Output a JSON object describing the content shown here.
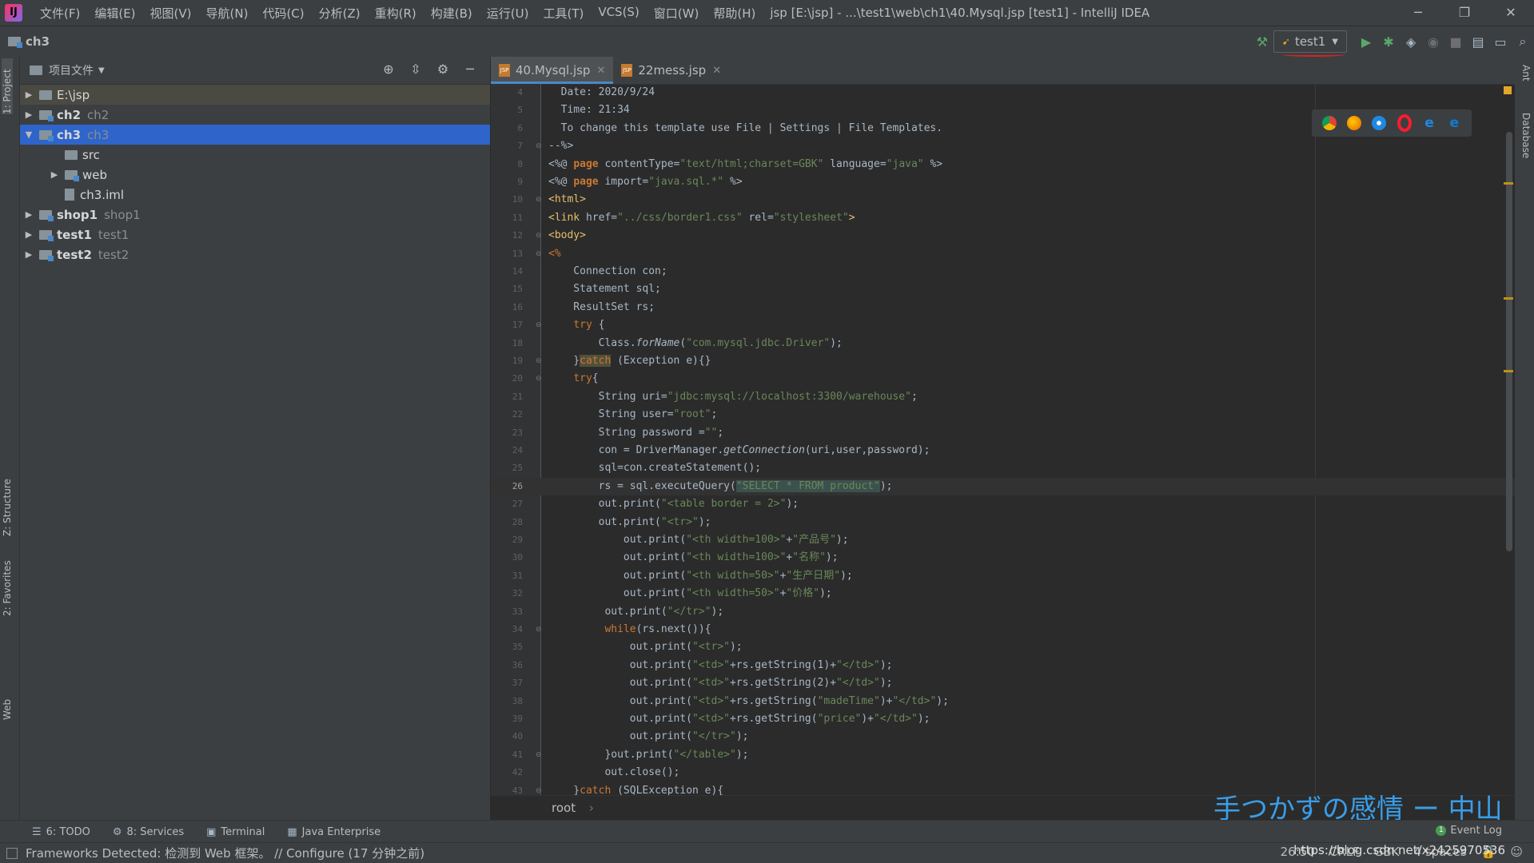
{
  "menubar": {
    "items": [
      "文件(F)",
      "编辑(E)",
      "视图(V)",
      "导航(N)",
      "代码(C)",
      "分析(Z)",
      "重构(R)",
      "构建(B)",
      "运行(U)",
      "工具(T)",
      "VCS(S)",
      "窗口(W)",
      "帮助(H)"
    ],
    "window_title": "jsp [E:\\jsp] - ...\\test1\\web\\ch1\\40.Mysql.jsp [test1] - IntelliJ IDEA"
  },
  "navbar": {
    "crumb": "ch3",
    "run_config": "test1"
  },
  "left_tabs": [
    "1: Project",
    "Z: Structure",
    "2: Favorites",
    "Web"
  ],
  "right_tabs": [
    "Ant",
    "Database"
  ],
  "project_panel": {
    "title": "项目文件",
    "tree": [
      {
        "name": "E:\\jsp",
        "sub": "",
        "depth": 0,
        "arrow": "▶",
        "bold": false,
        "state": "highlight",
        "icon": "folder"
      },
      {
        "name": "ch2",
        "sub": "ch2",
        "depth": 0,
        "arrow": "▶",
        "bold": true,
        "state": "",
        "icon": "module"
      },
      {
        "name": "ch3",
        "sub": "ch3",
        "depth": 0,
        "arrow": "▼",
        "bold": true,
        "state": "selected",
        "icon": "module"
      },
      {
        "name": "src",
        "sub": "",
        "depth": 1,
        "arrow": "",
        "bold": false,
        "state": "",
        "icon": "folder"
      },
      {
        "name": "web",
        "sub": "",
        "depth": 1,
        "arrow": "▶",
        "bold": false,
        "state": "",
        "icon": "folder"
      },
      {
        "name": "ch3.iml",
        "sub": "",
        "depth": 1,
        "arrow": "",
        "bold": false,
        "state": "",
        "icon": "file"
      },
      {
        "name": "shop1",
        "sub": "shop1",
        "depth": 0,
        "arrow": "▶",
        "bold": true,
        "state": "",
        "icon": "module"
      },
      {
        "name": "test1",
        "sub": "test1",
        "depth": 0,
        "arrow": "▶",
        "bold": true,
        "state": "",
        "icon": "module"
      },
      {
        "name": "test2",
        "sub": "test2",
        "depth": 0,
        "arrow": "▶",
        "bold": true,
        "state": "",
        "icon": "module"
      }
    ]
  },
  "editor": {
    "tabs": [
      {
        "label": "40.Mysql.jsp",
        "active": true
      },
      {
        "label": "22mess.jsp",
        "active": false
      }
    ],
    "current_line": 26,
    "lines": [
      {
        "n": 4,
        "fold": "",
        "segs": [
          [
            "",
            "  Date: 2020/9/24"
          ]
        ]
      },
      {
        "n": 5,
        "fold": "",
        "segs": [
          [
            "",
            "  Time: 21:34"
          ]
        ]
      },
      {
        "n": 6,
        "fold": "",
        "segs": [
          [
            "",
            "  To change this template use File | Settings | File Templates."
          ]
        ]
      },
      {
        "n": 7,
        "fold": "⊖",
        "segs": [
          [
            "",
            "--%>"
          ]
        ]
      },
      {
        "n": 8,
        "fold": "",
        "segs": [
          [
            "",
            "<%@ "
          ],
          [
            "dir",
            "page"
          ],
          [
            "",
            " contentType="
          ],
          [
            "str",
            "\"text/html;charset=GBK\""
          ],
          [
            "",
            " language="
          ],
          [
            "str",
            "\"java\""
          ],
          [
            "",
            " %>"
          ]
        ]
      },
      {
        "n": 9,
        "fold": "",
        "segs": [
          [
            "",
            "<%@ "
          ],
          [
            "dir",
            "page"
          ],
          [
            "",
            " import="
          ],
          [
            "str",
            "\"java.sql.*\""
          ],
          [
            "",
            " %>"
          ]
        ]
      },
      {
        "n": 10,
        "fold": "⊖",
        "segs": [
          [
            "tag",
            "<html>"
          ]
        ]
      },
      {
        "n": 11,
        "fold": "",
        "segs": [
          [
            "tag",
            "<link "
          ],
          [
            "",
            "href="
          ],
          [
            "str",
            "\"../css/border1.css\""
          ],
          [
            "",
            " rel="
          ],
          [
            "str",
            "\"stylesheet\""
          ],
          [
            "tag",
            ">"
          ]
        ]
      },
      {
        "n": 12,
        "fold": "⊖",
        "segs": [
          [
            "tag",
            "<body>"
          ]
        ]
      },
      {
        "n": 13,
        "fold": "⊖",
        "segs": [
          [
            "kw",
            "<%"
          ]
        ]
      },
      {
        "n": 14,
        "fold": "",
        "segs": [
          [
            "",
            "    Connection con;"
          ]
        ]
      },
      {
        "n": 15,
        "fold": "",
        "segs": [
          [
            "",
            "    Statement sql;"
          ]
        ]
      },
      {
        "n": 16,
        "fold": "",
        "segs": [
          [
            "",
            "    ResultSet rs;"
          ]
        ]
      },
      {
        "n": 17,
        "fold": "⊖",
        "segs": [
          [
            "",
            "    "
          ],
          [
            "kw",
            "try"
          ],
          [
            "",
            " {"
          ]
        ]
      },
      {
        "n": 18,
        "fold": "",
        "segs": [
          [
            "",
            "        Class."
          ],
          [
            "it",
            "forName"
          ],
          [
            "",
            "("
          ],
          [
            "str",
            "\"com.mysql.jdbc.Driver\""
          ],
          [
            "",
            ");"
          ]
        ]
      },
      {
        "n": 19,
        "fold": "⊖",
        "segs": [
          [
            "",
            "    }"
          ],
          [
            "warn",
            "catch"
          ],
          [
            "",
            " (Exception e){}"
          ]
        ]
      },
      {
        "n": 20,
        "fold": "⊖",
        "segs": [
          [
            "",
            "    "
          ],
          [
            "kw",
            "try"
          ],
          [
            "",
            "{"
          ]
        ]
      },
      {
        "n": 21,
        "fold": "",
        "segs": [
          [
            "",
            "        String uri="
          ],
          [
            "str",
            "\"jdbc:mysql://localhost:3300/warehouse\""
          ],
          [
            "",
            ";"
          ]
        ]
      },
      {
        "n": 22,
        "fold": "",
        "segs": [
          [
            "",
            "        String user="
          ],
          [
            "str",
            "\"root\""
          ],
          [
            "",
            ";"
          ]
        ]
      },
      {
        "n": 23,
        "fold": "",
        "segs": [
          [
            "",
            "        String password ="
          ],
          [
            "str",
            "\"\""
          ],
          [
            "",
            ";"
          ]
        ]
      },
      {
        "n": 24,
        "fold": "",
        "segs": [
          [
            "",
            "        con = DriverManager."
          ],
          [
            "it",
            "getConnection"
          ],
          [
            "",
            "(uri,user,password);"
          ]
        ]
      },
      {
        "n": 25,
        "fold": "",
        "segs": [
          [
            "",
            "        sql=con.createStatement();"
          ]
        ]
      },
      {
        "n": 26,
        "fold": "",
        "segs": [
          [
            "",
            "        rs = sql.executeQuery("
          ],
          [
            "strhl",
            "\"SELECT * FROM product\""
          ],
          [
            "",
            ");"
          ]
        ]
      },
      {
        "n": 27,
        "fold": "",
        "segs": [
          [
            "",
            "        out.print("
          ],
          [
            "str",
            "\"<table border = 2>\""
          ],
          [
            "",
            ");"
          ]
        ]
      },
      {
        "n": 28,
        "fold": "",
        "segs": [
          [
            "",
            "        out.print("
          ],
          [
            "str",
            "\"<tr>\""
          ],
          [
            "",
            ");"
          ]
        ]
      },
      {
        "n": 29,
        "fold": "",
        "segs": [
          [
            "",
            "            out.print("
          ],
          [
            "str",
            "\"<th width=100>\""
          ],
          [
            "",
            "+"
          ],
          [
            "str",
            "\"产品号\""
          ],
          [
            "",
            ");"
          ]
        ]
      },
      {
        "n": 30,
        "fold": "",
        "segs": [
          [
            "",
            "            out.print("
          ],
          [
            "str",
            "\"<th width=100>\""
          ],
          [
            "",
            "+"
          ],
          [
            "str",
            "\"名称\""
          ],
          [
            "",
            ");"
          ]
        ]
      },
      {
        "n": 31,
        "fold": "",
        "segs": [
          [
            "",
            "            out.print("
          ],
          [
            "str",
            "\"<th width=50>\""
          ],
          [
            "",
            "+"
          ],
          [
            "str",
            "\"生产日期\""
          ],
          [
            "",
            ");"
          ]
        ]
      },
      {
        "n": 32,
        "fold": "",
        "segs": [
          [
            "",
            "            out.print("
          ],
          [
            "str",
            "\"<th width=50>\""
          ],
          [
            "",
            "+"
          ],
          [
            "str",
            "\"价格\""
          ],
          [
            "",
            ");"
          ]
        ]
      },
      {
        "n": 33,
        "fold": "",
        "segs": [
          [
            "",
            "         out.print("
          ],
          [
            "str",
            "\"</tr>\""
          ],
          [
            "",
            ");"
          ]
        ]
      },
      {
        "n": 34,
        "fold": "⊖",
        "segs": [
          [
            "",
            "         "
          ],
          [
            "kw",
            "while"
          ],
          [
            "",
            "(rs.next()){"
          ]
        ]
      },
      {
        "n": 35,
        "fold": "",
        "segs": [
          [
            "",
            "             out.print("
          ],
          [
            "str",
            "\"<tr>\""
          ],
          [
            "",
            ");"
          ]
        ]
      },
      {
        "n": 36,
        "fold": "",
        "segs": [
          [
            "",
            "             out.print("
          ],
          [
            "str",
            "\"<td>\""
          ],
          [
            "",
            "+rs.getString(1)+"
          ],
          [
            "str",
            "\"</td>\""
          ],
          [
            "",
            ");"
          ]
        ]
      },
      {
        "n": 37,
        "fold": "",
        "segs": [
          [
            "",
            "             out.print("
          ],
          [
            "str",
            "\"<td>\""
          ],
          [
            "",
            "+rs.getString(2)+"
          ],
          [
            "str",
            "\"</td>\""
          ],
          [
            "",
            ");"
          ]
        ]
      },
      {
        "n": 38,
        "fold": "",
        "segs": [
          [
            "",
            "             out.print("
          ],
          [
            "str",
            "\"<td>\""
          ],
          [
            "",
            "+rs.getString("
          ],
          [
            "str",
            "\"madeTime\""
          ],
          [
            "",
            ")+"
          ],
          [
            "str",
            "\"</td>\""
          ],
          [
            "",
            ");"
          ]
        ]
      },
      {
        "n": 39,
        "fold": "",
        "segs": [
          [
            "",
            "             out.print("
          ],
          [
            "str",
            "\"<td>\""
          ],
          [
            "",
            "+rs.getString("
          ],
          [
            "str",
            "\"price\""
          ],
          [
            "",
            ")+"
          ],
          [
            "str",
            "\"</td>\""
          ],
          [
            "",
            ");"
          ]
        ]
      },
      {
        "n": 40,
        "fold": "",
        "segs": [
          [
            "",
            "             out.print("
          ],
          [
            "str",
            "\"</tr>\""
          ],
          [
            "",
            ");"
          ]
        ]
      },
      {
        "n": 41,
        "fold": "⊖",
        "segs": [
          [
            "",
            "         }out.print("
          ],
          [
            "str",
            "\"</table>\""
          ],
          [
            "",
            ");"
          ]
        ]
      },
      {
        "n": 42,
        "fold": "",
        "segs": [
          [
            "",
            "         out.close();"
          ]
        ]
      },
      {
        "n": 43,
        "fold": "⊖",
        "segs": [
          [
            "",
            "    }"
          ],
          [
            "kw",
            "catch"
          ],
          [
            "",
            " (SQLException e){"
          ]
        ]
      }
    ],
    "breadcrumb": "root",
    "breadcrumb_sep": "›"
  },
  "overlay_text": "手つかずの感情 ー 中山",
  "toolwindows": [
    {
      "label": "6: TODO",
      "icon": "☰"
    },
    {
      "label": "8: Services",
      "icon": "⚙"
    },
    {
      "label": "Terminal",
      "icon": "▣"
    },
    {
      "label": "Java Enterprise",
      "icon": "▦"
    }
  ],
  "event_log": {
    "label": "Event Log",
    "count": "1"
  },
  "status": {
    "message": "Frameworks Detected: 检测到 Web 框架。 // Configure (17 分钟之前)",
    "position": "26:50",
    "line_sep": "CRLF",
    "encoding": "GBK",
    "indent": "4 spaces",
    "watermark": "https://blog.csdn.net/x2425970536"
  },
  "colors": {
    "accent": "#4a88c7",
    "selection": "#2f65ca",
    "keyword": "#cc7832",
    "string": "#6a8759"
  }
}
